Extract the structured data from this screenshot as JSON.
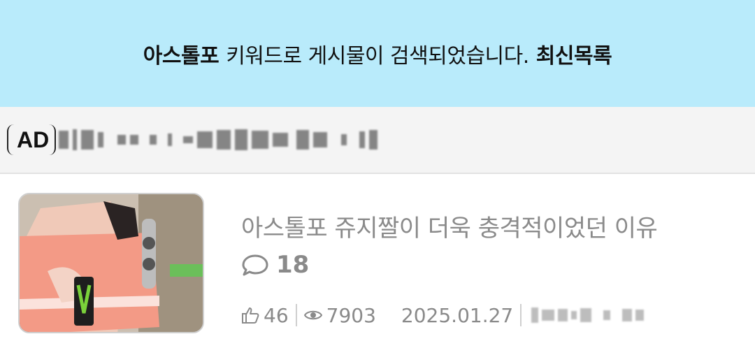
{
  "search_banner": {
    "keyword": "아스톨포",
    "message": "키워드로 게시물이 검색되었습니다.",
    "latest_link": "최신목록",
    "background_color": "#b9ebfb"
  },
  "ad_bar": {
    "badge": "AD"
  },
  "post": {
    "title": "아스톨포 쥬지짤이 더욱 충격적이었던 이유",
    "comment_count": "18",
    "likes": "46",
    "views": "7903",
    "date": "2025.01.27",
    "icons": {
      "comment": "speech-bubble-icon",
      "like": "thumbs-up-icon",
      "views": "eye-icon"
    }
  }
}
